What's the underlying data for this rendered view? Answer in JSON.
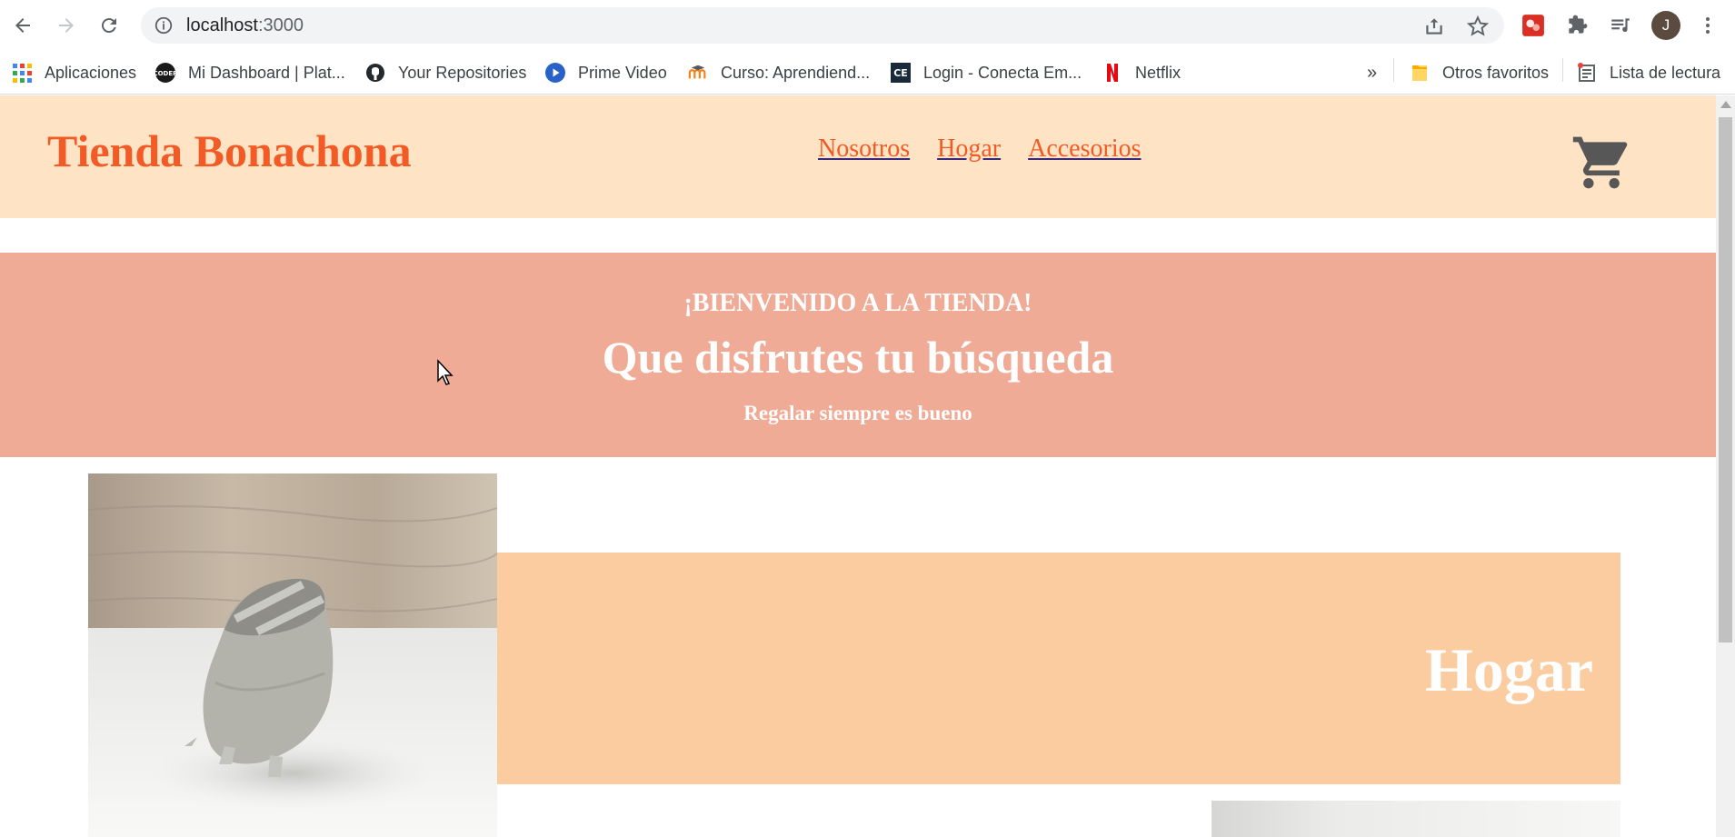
{
  "browser": {
    "url_host": "localhost",
    "url_port": ":3000",
    "avatar_letter": "J",
    "bookmarks": [
      {
        "label": "Aplicaciones",
        "icon": "apps-grid-icon"
      },
      {
        "label": "Mi Dashboard | Plat...",
        "icon": "coder-icon"
      },
      {
        "label": "Your Repositories",
        "icon": "github-icon"
      },
      {
        "label": "Prime Video",
        "icon": "prime-video-icon"
      },
      {
        "label": "Curso: Aprendiend...",
        "icon": "moodle-icon"
      },
      {
        "label": "Login - Conecta Em...",
        "icon": "ce-icon"
      },
      {
        "label": "Netflix",
        "icon": "netflix-icon"
      }
    ],
    "overflow_label": "»",
    "other_favorites": "Otros favoritos",
    "reading_list": "Lista de lectura"
  },
  "site": {
    "brand": "Tienda Bonachona",
    "nav": [
      "Nosotros",
      "Hogar",
      "Accesorios"
    ],
    "hero": {
      "kicker": "¡BIENVENIDO A LA TIENDA!",
      "headline": "Que disfrutes tu búsqueda",
      "tagline": "Regalar siempre es bueno"
    },
    "category_title": "Hogar"
  },
  "colors": {
    "header_bg": "#fee3c4",
    "brand": "#f25b25",
    "hero_bg": "#f0ab97",
    "category_band": "#fbcca0"
  }
}
